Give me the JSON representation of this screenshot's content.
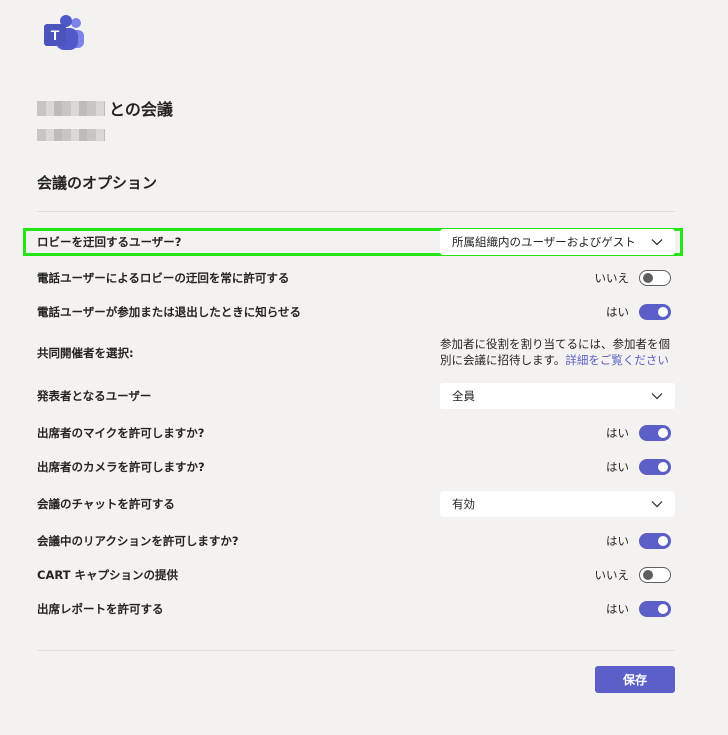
{
  "meeting": {
    "title_suffix": "との会議"
  },
  "section_title": "会議のオプション",
  "options": {
    "bypass_lobby": {
      "label": "ロビーを迂回するユーザー?",
      "value": "所属組織内のユーザーおよびゲスト"
    },
    "phone_bypass": {
      "label": "電話ユーザーによるロビーの迂回を常に許可する",
      "state": "いいえ",
      "on": false
    },
    "phone_notify": {
      "label": "電話ユーザーが参加または退出したときに知らせる",
      "state": "はい",
      "on": true
    },
    "cohost": {
      "label": "共同開催者を選択:",
      "desc": "参加者に役割を割り当てるには、参加者を個別に会議に招待します。",
      "link": "詳細をご覧ください"
    },
    "presenters": {
      "label": "発表者となるユーザー",
      "value": "全員"
    },
    "mic": {
      "label": "出席者のマイクを許可しますか?",
      "state": "はい",
      "on": true
    },
    "camera": {
      "label": "出席者のカメラを許可しますか?",
      "state": "はい",
      "on": true
    },
    "chat": {
      "label": "会議のチャットを許可する",
      "value": "有効"
    },
    "reactions": {
      "label": "会議中のリアクションを許可しますか?",
      "state": "はい",
      "on": true
    },
    "cart": {
      "label": "CART キャプションの提供",
      "state": "いいえ",
      "on": false
    },
    "attendance": {
      "label": "出席レポートを許可する",
      "state": "はい",
      "on": true
    }
  },
  "save_label": "保存",
  "colors": {
    "accent": "#5b5fc7",
    "highlight": "#22e614",
    "background": "#f3f2f1"
  },
  "icons": {
    "logo": "teams-logo-icon",
    "dropdown": "chevron-down-icon"
  }
}
